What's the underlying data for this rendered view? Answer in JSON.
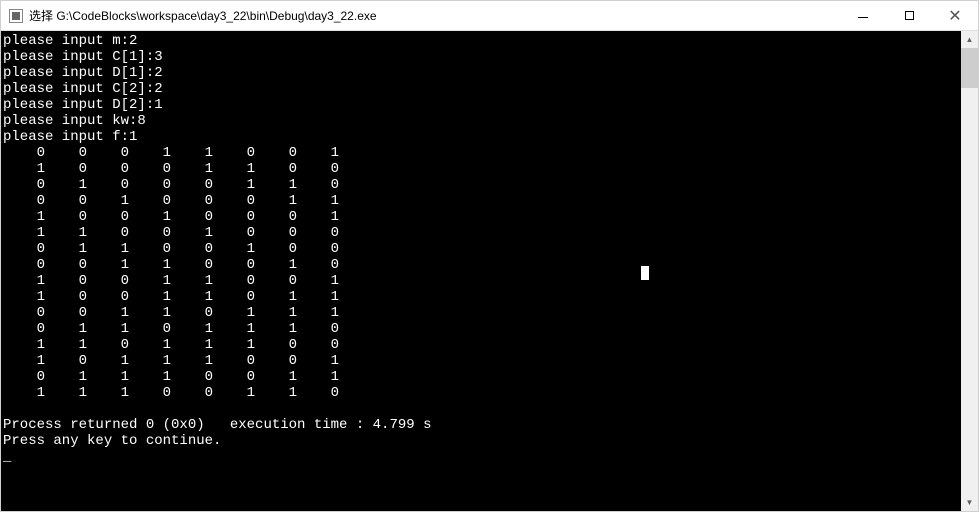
{
  "window": {
    "title": "选择 G:\\CodeBlocks\\workspace\\day3_22\\bin\\Debug\\day3_22.exe"
  },
  "prompts": {
    "m": "please input m:2",
    "c1": "please input C[1]:3",
    "d1": "please input D[1]:2",
    "c2": "please input C[2]:2",
    "d2": "please input D[2]:1",
    "kw": "please input kw:8",
    "f": "please input f:1"
  },
  "matrix": [
    [
      0,
      0,
      0,
      1,
      1,
      0,
      0,
      1
    ],
    [
      1,
      0,
      0,
      0,
      1,
      1,
      0,
      0
    ],
    [
      0,
      1,
      0,
      0,
      0,
      1,
      1,
      0
    ],
    [
      0,
      0,
      1,
      0,
      0,
      0,
      1,
      1
    ],
    [
      1,
      0,
      0,
      1,
      0,
      0,
      0,
      1
    ],
    [
      1,
      1,
      0,
      0,
      1,
      0,
      0,
      0
    ],
    [
      0,
      1,
      1,
      0,
      0,
      1,
      0,
      0
    ],
    [
      0,
      0,
      1,
      1,
      0,
      0,
      1,
      0
    ],
    [
      1,
      0,
      0,
      1,
      1,
      0,
      0,
      1
    ],
    [
      1,
      0,
      0,
      1,
      1,
      0,
      1,
      1
    ],
    [
      0,
      0,
      1,
      1,
      0,
      1,
      1,
      1
    ],
    [
      0,
      1,
      1,
      0,
      1,
      1,
      1,
      0
    ],
    [
      1,
      1,
      0,
      1,
      1,
      1,
      0,
      0
    ],
    [
      1,
      0,
      1,
      1,
      1,
      0,
      0,
      1
    ],
    [
      0,
      1,
      1,
      1,
      0,
      0,
      1,
      1
    ],
    [
      1,
      1,
      1,
      0,
      0,
      1,
      1,
      0
    ]
  ],
  "footer": {
    "process": "Process returned 0 (0x0)   execution time : 4.799 s",
    "press": "Press any key to continue."
  }
}
